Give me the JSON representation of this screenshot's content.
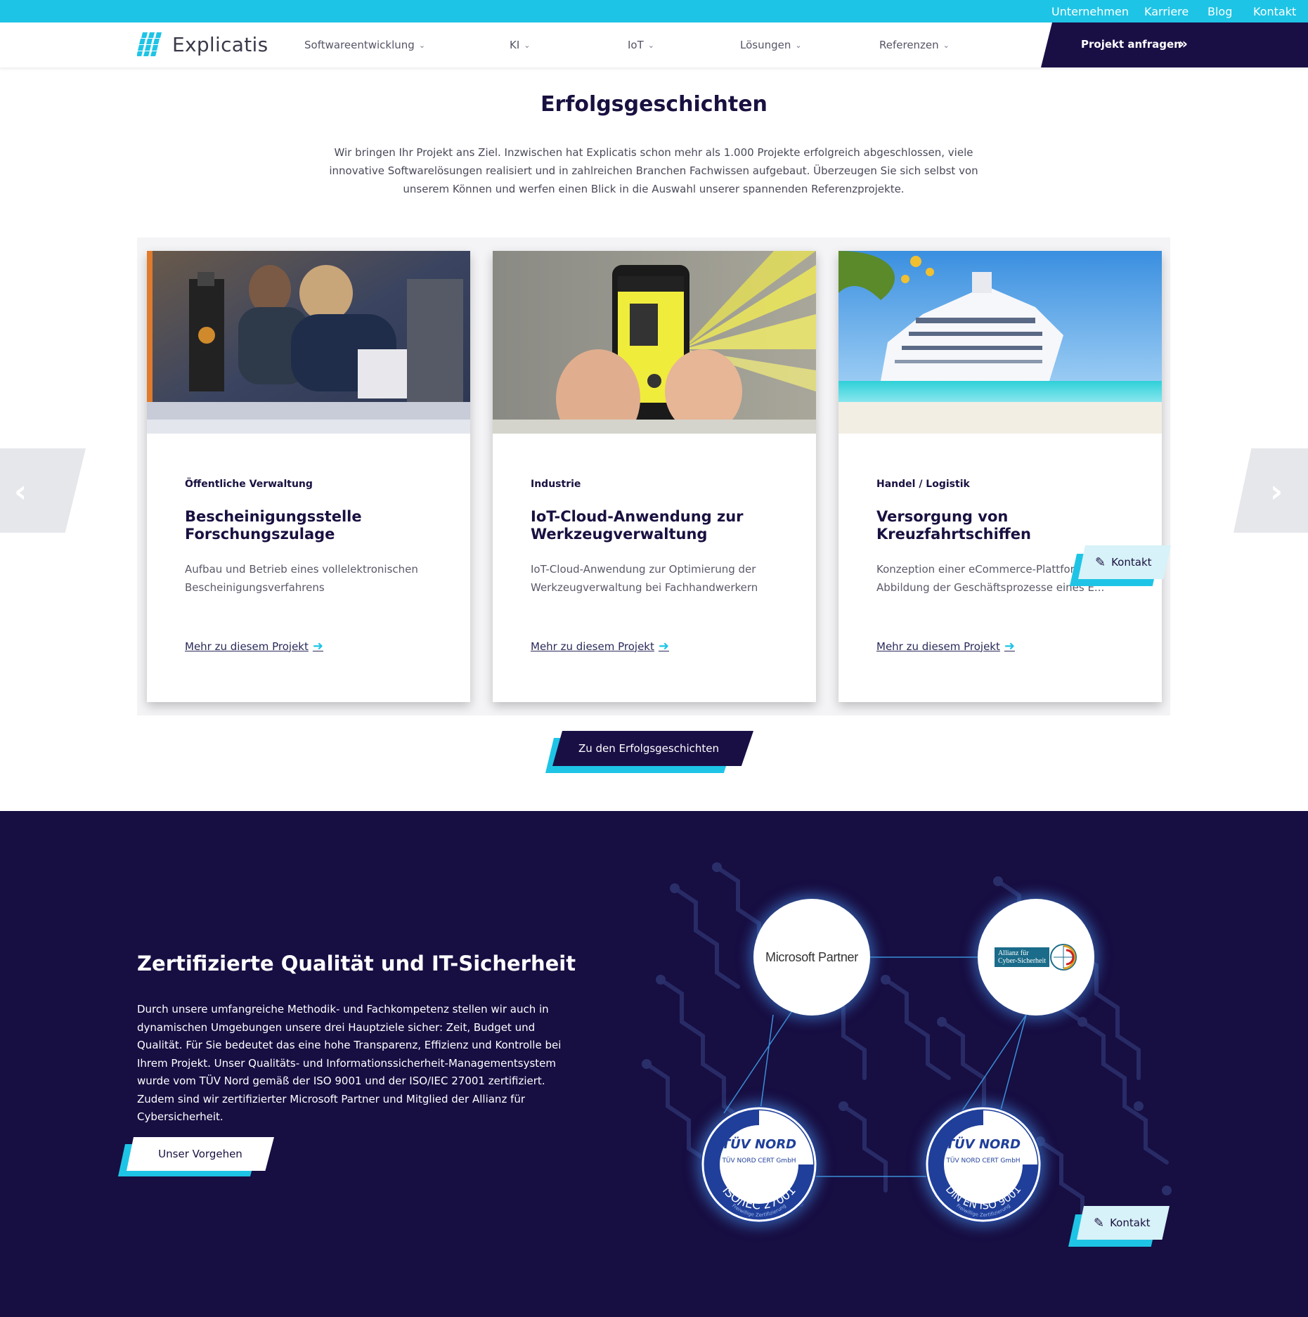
{
  "topbar": {
    "links": [
      "Unternehmen",
      "Karriere",
      "Blog",
      "Kontakt"
    ]
  },
  "nav": {
    "brand": "Explicatis",
    "items": [
      "Softwareentwicklung",
      "KI",
      "IoT",
      "Lösungen",
      "Referenzen"
    ],
    "cta": "Projekt anfragen"
  },
  "stories": {
    "title": "Erfolgsgeschichten",
    "intro": "Wir bringen Ihr Projekt ans Ziel. Inzwischen hat Explicatis schon mehr als 1.000 Projekte erfolgreich abgeschlossen, viele innovative Softwarelösungen realisiert und in zahlreichen Branchen Fachwissen aufgebaut. Überzeugen Sie sich selbst von unserem Können und werfen einen Blick in die Auswahl unserer spannenden Referenzprojekte.",
    "cards": [
      {
        "category": "Öffentliche Verwaltung",
        "title": "Bescheinigungsstelle Forschungszulage",
        "description": "Aufbau und Betrieb eines vollelektronischen Bescheinigungsverfahrens",
        "link": "Mehr zu diesem Projekt"
      },
      {
        "category": "Industrie",
        "title": "IoT-Cloud-Anwendung zur Werkzeugverwaltung",
        "description": "IoT-Cloud-Anwendung zur Optimierung der Werkzeugverwaltung bei Fachhandwerkern",
        "link": "Mehr zu diesem Projekt"
      },
      {
        "category": "Handel / Logistik",
        "title": "Versorgung von Kreuzfahrtschiffen",
        "description": "Konzeption einer eCommerce-Plattform Abbildung der Geschäftsprozesse eines E...",
        "link": "Mehr zu diesem Projekt"
      }
    ],
    "button": "Zu den Erfolgsgeschichten"
  },
  "kontakt_label": "Kontakt",
  "quality": {
    "title": "Zertifizierte Qualität und IT-Sicherheit",
    "text": "Durch unsere umfangreiche Methodik- und Fachkompetenz stellen wir auch in dynamischen Umgebungen unsere drei Hauptziele sicher: Zeit, Budget und Qualität. Für Sie bedeutet das eine hohe Transparenz, Effizienz und Kontrolle bei Ihrem Projekt. Unser Qualitäts- und Informationssicherheit-Managementsystem wurde vom TÜV Nord gemäß der ISO 9001 und der ISO/IEC 27001 zertifiziert. Zudem sind wir zertifizierter Microsoft Partner und Mitglied der Allianz für Cybersicherheit.",
    "button": "Unser Vorgehen",
    "badges": {
      "microsoft": "Microsoft Partner",
      "allianz_line1": "Allianz für",
      "allianz_line2": "Cyber-Sicherheit",
      "tuv_brand": "TÜV NORD",
      "tuv_cert": "TÜV NORD CERT GmbH",
      "tuv1_std": "ISO/IEC 27001",
      "tuv2_std": "DIN EN ISO 9001",
      "tuv_note": "Freiwillige Zertifizierung"
    }
  },
  "colors": {
    "accent": "#1ec4e5",
    "dark": "#170e42",
    "navy": "#1a0f45"
  }
}
